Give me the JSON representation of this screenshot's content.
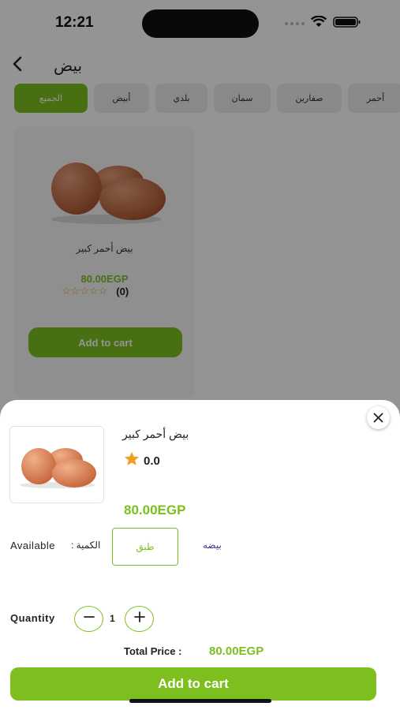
{
  "status_bar": {
    "time": "12:21",
    "icons": [
      "signal-icon",
      "wifi-icon",
      "battery-icon"
    ]
  },
  "header": {
    "back_icon": "chevron-left-icon",
    "title": "بيض"
  },
  "chips": [
    {
      "label": "الجميع",
      "active": true
    },
    {
      "label": "أبيض",
      "active": false
    },
    {
      "label": "بلدي",
      "active": false
    },
    {
      "label": "سمان",
      "active": false
    },
    {
      "label": "صفارين",
      "active": false
    },
    {
      "label": "أحمر",
      "active": false
    }
  ],
  "product_card": {
    "name": "بيض أحمر كبير",
    "price": "80.00EGP",
    "stars": "☆☆☆☆☆",
    "rating_count": "(0)",
    "button_label": "Add to cart"
  },
  "sheet": {
    "close_icon": "close-icon",
    "product_name": "بيض أحمر كبير",
    "rating": "0.0",
    "price": "80.00EGP",
    "available_label": "Available",
    "quantity_unit_label": ": الكمية",
    "option_label": "طبق",
    "unit_label": "بيضه",
    "quantity_label": "Quantity",
    "quantity_value": "1",
    "total_label": "Total Price :",
    "total_value": "80.00EGP",
    "add_button_label": "Add to cart"
  },
  "colors": {
    "accent": "#7cbf1e",
    "star": "#f0a020"
  }
}
